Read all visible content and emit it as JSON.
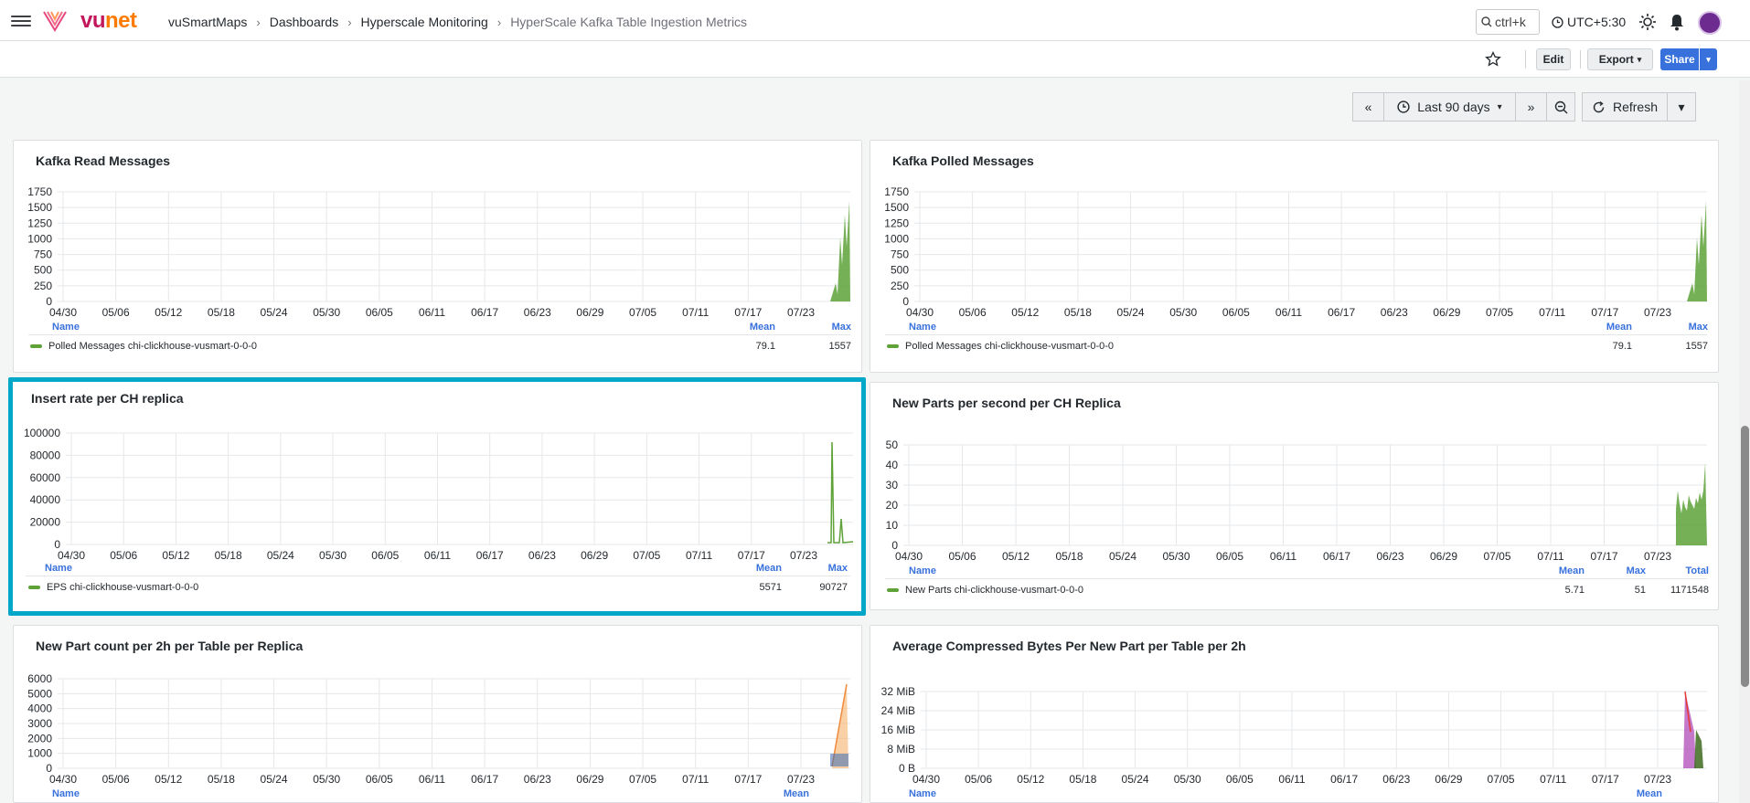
{
  "header": {
    "logo_text_vu": "vu",
    "logo_text_net": "net",
    "breadcrumbs": [
      "vuSmartMaps",
      "Dashboards",
      "Hyperscale Monitoring",
      "HyperScale Kafka Table Ingestion Metrics"
    ],
    "search_placeholder": "ctrl+k",
    "timezone": "UTC+5:30"
  },
  "toolbar": {
    "edit_label": "Edit",
    "export_label": "Export",
    "share_label": "Share"
  },
  "timepicker": {
    "range_label": "Last 90 days",
    "refresh_label": "Refresh"
  },
  "colors": {
    "accent": "#3871dc",
    "series_green": "#5ea238",
    "selected_border": "#00a7c9"
  },
  "x_ticks": [
    "04/30",
    "05/06",
    "05/12",
    "05/18",
    "05/24",
    "05/30",
    "06/05",
    "06/11",
    "06/17",
    "06/23",
    "06/29",
    "07/05",
    "07/11",
    "07/17",
    "07/23"
  ],
  "panels": [
    {
      "title": "Kafka Read Messages",
      "y_ticks": [
        "1750",
        "1500",
        "1250",
        "1000",
        "750",
        "500",
        "250",
        "0"
      ],
      "legend_headers": [
        "Name",
        "Mean",
        "Max"
      ],
      "legend": [
        {
          "name": "Polled Messages chi-clickhouse-vusmart-0-0-0",
          "values": [
            "79.1",
            "1557"
          ]
        }
      ]
    },
    {
      "title": "Kafka Polled Messages",
      "y_ticks": [
        "1750",
        "1500",
        "1250",
        "1000",
        "750",
        "500",
        "250",
        "0"
      ],
      "legend_headers": [
        "Name",
        "Mean",
        "Max"
      ],
      "legend": [
        {
          "name": "Polled Messages chi-clickhouse-vusmart-0-0-0",
          "values": [
            "79.1",
            "1557"
          ]
        }
      ]
    },
    {
      "title": "Insert rate per CH replica",
      "y_ticks": [
        "100000",
        "80000",
        "60000",
        "40000",
        "20000",
        "0"
      ],
      "legend_headers": [
        "Name",
        "Mean",
        "Max"
      ],
      "legend": [
        {
          "name": "EPS chi-clickhouse-vusmart-0-0-0",
          "values": [
            "5571",
            "90727"
          ]
        }
      ]
    },
    {
      "title": "New Parts per second per CH Replica",
      "y_ticks": [
        "50",
        "40",
        "30",
        "20",
        "10",
        "0"
      ],
      "legend_headers": [
        "Name",
        "Mean",
        "Max",
        "Total"
      ],
      "legend": [
        {
          "name": "New Parts chi-clickhouse-vusmart-0-0-0",
          "values": [
            "5.71",
            "51",
            "1171548"
          ]
        }
      ]
    },
    {
      "title": "New Part count per 2h per Table per Replica",
      "y_ticks": [
        "6000",
        "5000",
        "4000",
        "3000",
        "2000",
        "1000",
        "0"
      ],
      "legend_headers": [
        "Name",
        "Mean"
      ],
      "legend": []
    },
    {
      "title": "Average Compressed Bytes Per New Part per Table per 2h",
      "y_ticks": [
        "32 MiB",
        "24 MiB",
        "16 MiB",
        "8 MiB",
        "0 B"
      ],
      "legend_headers": [
        "Name",
        "Mean"
      ],
      "legend": []
    }
  ]
}
